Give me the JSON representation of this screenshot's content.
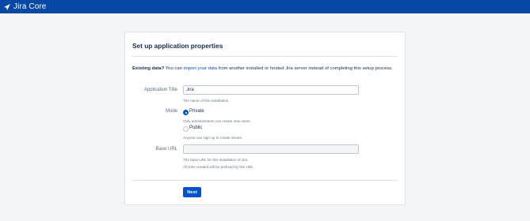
{
  "header": {
    "product_name": "Jira Core",
    "logo_icon": "jira-logo-icon",
    "background_color": "#0747a6"
  },
  "form": {
    "title": "Set up application properties",
    "intro": {
      "bold": "Existing data?",
      "before_link": " You can ",
      "link": "import your data",
      "after_link": " from another installed or hosted Jira server instead of completing this setup process."
    },
    "application_title": {
      "label": "Application Title",
      "value": "Jira",
      "help": "The name of this installation."
    },
    "mode": {
      "label": "Mode",
      "options": [
        {
          "label": "Private",
          "help": "Only administrators can create new users.",
          "selected": true
        },
        {
          "label": "Public",
          "help": "Anyone can sign up to create issues.",
          "selected": false
        }
      ]
    },
    "base_url": {
      "label": "Base URL",
      "value": "",
      "help_line1": "The base URL for this installation of Jira.",
      "help_line2": "All links created will be prefixed by this URL."
    },
    "next_label": "Next",
    "accent_color": "#0052cc"
  }
}
